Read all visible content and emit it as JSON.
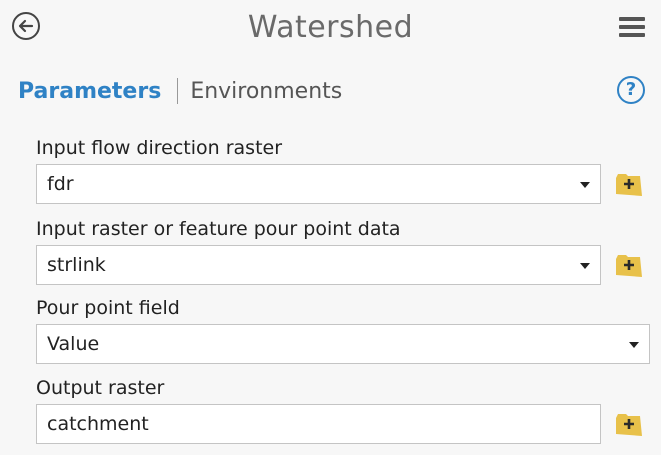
{
  "header": {
    "title": "Watershed"
  },
  "tabs": {
    "parameters": "Parameters",
    "environments": "Environments"
  },
  "help": {
    "label": "?"
  },
  "fields": [
    {
      "label": "Input flow direction raster",
      "value": "fdr",
      "type": "dropdown"
    },
    {
      "label": "Input raster or feature pour point data",
      "value": "strlink",
      "type": "dropdown"
    },
    {
      "label": "Pour point field",
      "value": "Value",
      "type": "dropdown"
    },
    {
      "label": "Output raster",
      "value": "catchment",
      "type": "text"
    }
  ],
  "colors": {
    "accent": "#2f82c5",
    "folder": "#e8c14a",
    "folder_plus": "#2a2a2a"
  }
}
